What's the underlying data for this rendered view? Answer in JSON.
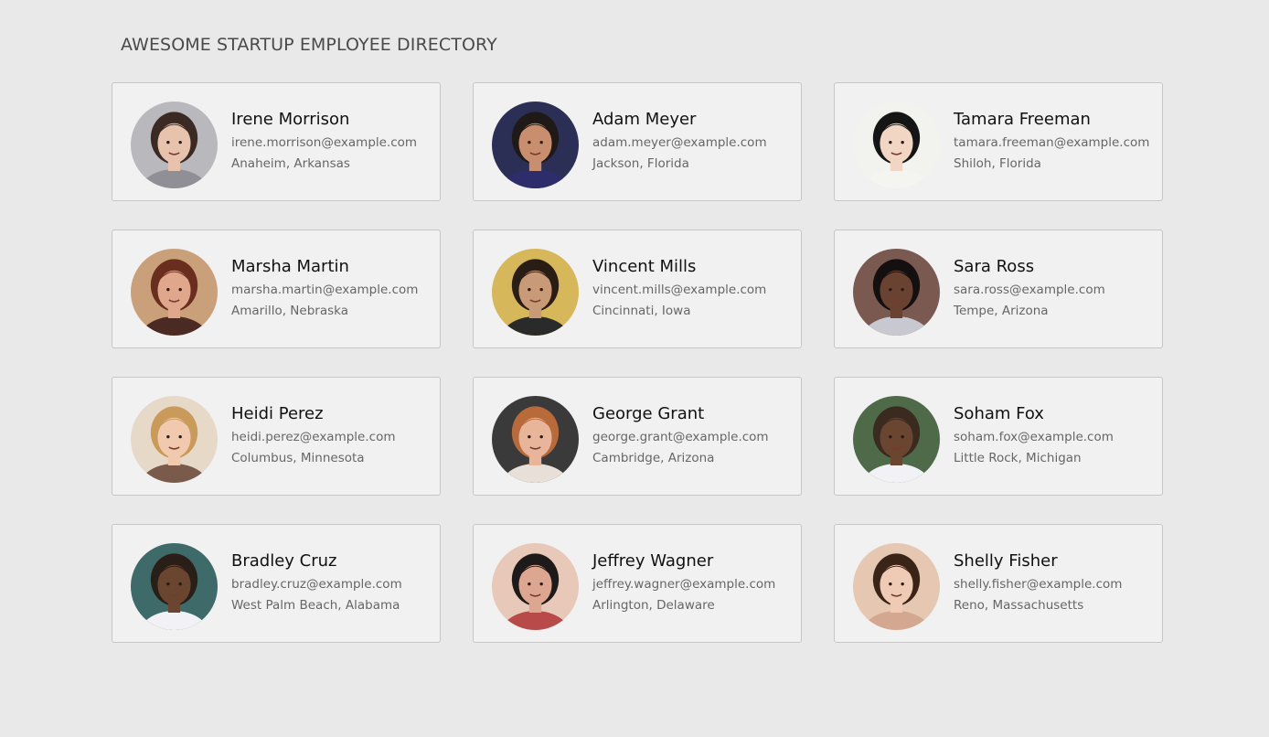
{
  "page": {
    "title": "AWESOME STARTUP EMPLOYEE DIRECTORY"
  },
  "employees": [
    {
      "name": "Irene Morrison",
      "email": "irene.morrison@example.com",
      "location": "Anaheim, Arkansas",
      "photo": {
        "icon": "portrait-photo",
        "bg": "#b9b9bd",
        "skin": "#e7c3ae",
        "hair": "#3b2a24",
        "shirt": "#8f8f95"
      }
    },
    {
      "name": "Adam Meyer",
      "email": "adam.meyer@example.com",
      "location": "Jackson, Florida",
      "photo": {
        "icon": "portrait-photo",
        "bg": "#2b2f55",
        "skin": "#c98e6d",
        "hair": "#1f1a18",
        "shirt": "#2d2d6b"
      }
    },
    {
      "name": "Tamara Freeman",
      "email": "tamara.freeman@example.com",
      "location": "Shiloh, Florida",
      "photo": {
        "icon": "portrait-photo",
        "bg": "#f2f2ee",
        "skin": "#f2d6c4",
        "hair": "#151515",
        "shirt": "#f4f4f0"
      }
    },
    {
      "name": "Marsha Martin",
      "email": "marsha.martin@example.com",
      "location": "Amarillo, Nebraska",
      "photo": {
        "icon": "portrait-photo",
        "bg": "#c9a07a",
        "skin": "#e0a78c",
        "hair": "#6a2e1e",
        "shirt": "#4a2a22"
      }
    },
    {
      "name": "Vincent Mills",
      "email": "vincent.mills@example.com",
      "location": "Cincinnati, Iowa",
      "photo": {
        "icon": "portrait-photo",
        "bg": "#d6b75a",
        "skin": "#c99a78",
        "hair": "#2a1d16",
        "shirt": "#2a2a2a"
      }
    },
    {
      "name": "Sara Ross",
      "email": "sara.ross@example.com",
      "location": "Tempe, Arizona",
      "photo": {
        "icon": "portrait-photo",
        "bg": "#7a5a50",
        "skin": "#6a4232",
        "hair": "#141010",
        "shirt": "#c8c8d0"
      }
    },
    {
      "name": "Heidi Perez",
      "email": "heidi.perez@example.com",
      "location": "Columbus, Minnesota",
      "photo": {
        "icon": "portrait-photo",
        "bg": "#e7d9c8",
        "skin": "#f0c9ae",
        "hair": "#c99a5a",
        "shirt": "#7a5a4a"
      }
    },
    {
      "name": "George Grant",
      "email": "george.grant@example.com",
      "location": "Cambridge, Arizona",
      "photo": {
        "icon": "portrait-photo",
        "bg": "#3a3a3a",
        "skin": "#e8b49a",
        "hair": "#b86a3a",
        "shirt": "#e8e0d8"
      }
    },
    {
      "name": "Soham Fox",
      "email": "soham.fox@example.com",
      "location": "Little Rock, Michigan",
      "photo": {
        "icon": "portrait-photo",
        "bg": "#4f6a48",
        "skin": "#6a4530",
        "hair": "#3a2a20",
        "shirt": "#f2f2f6"
      }
    },
    {
      "name": "Bradley Cruz",
      "email": "bradley.cruz@example.com",
      "location": "West Palm Beach, Alabama",
      "photo": {
        "icon": "portrait-photo",
        "bg": "#3f6a6a",
        "skin": "#6a4530",
        "hair": "#2a1e18",
        "shirt": "#f2f2f6"
      }
    },
    {
      "name": "Jeffrey Wagner",
      "email": "jeffrey.wagner@example.com",
      "location": "Arlington, Delaware",
      "photo": {
        "icon": "portrait-photo",
        "bg": "#e8c8b8",
        "skin": "#dca690",
        "hair": "#1e1a1a",
        "shirt": "#b84a4a"
      }
    },
    {
      "name": "Shelly Fisher",
      "email": "shelly.fisher@example.com",
      "location": "Reno, Massachusetts",
      "photo": {
        "icon": "portrait-photo",
        "bg": "#e6c8b2",
        "skin": "#efcab4",
        "hair": "#3a2418",
        "shirt": "#d4a890"
      }
    }
  ]
}
